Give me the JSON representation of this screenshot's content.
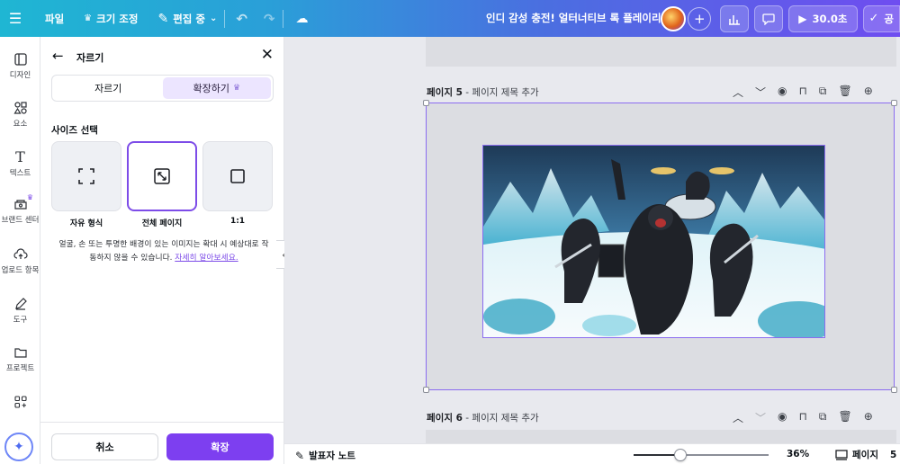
{
  "topbar": {
    "file_label": "파일",
    "resize_label": "크기 조정",
    "edit_label": "편집 중",
    "doc_title": "인디 감성 충전! 얼터너티브 록 플레이리스트",
    "present_label": "30.0초",
    "share_label": "공"
  },
  "rail": {
    "items": [
      {
        "label": "디자인",
        "icon": "layout-icon"
      },
      {
        "label": "요소",
        "icon": "elements-icon"
      },
      {
        "label": "텍스트",
        "icon": "text-icon"
      },
      {
        "label": "브랜드 센터",
        "icon": "brand-icon"
      },
      {
        "label": "업로드 항목",
        "icon": "upload-icon"
      },
      {
        "label": "도구",
        "icon": "draw-icon"
      },
      {
        "label": "프로젝트",
        "icon": "folder-icon"
      },
      {
        "label": "",
        "icon": "apps-icon"
      }
    ]
  },
  "panel": {
    "title": "자르기",
    "tab_crop": "자르기",
    "tab_expand": "확장하기",
    "section_title": "사이즈 선택",
    "options": [
      {
        "label": "자유 형식",
        "glyph": "⛶"
      },
      {
        "label": "전체 페이지",
        "glyph": "⤡"
      },
      {
        "label": "1:1",
        "glyph": "▢"
      }
    ],
    "note_text": "얼굴, 손 또는 투명한 배경이 있는 이미지는 확대 시 예상대로 작동하지 않을 수 있습니다.",
    "note_link": "자세히 알아보세요.",
    "cancel_label": "취소",
    "expand_label": "확장"
  },
  "canvas": {
    "page5_label": "페이지 5",
    "page5_title": "페이지 제목 추가",
    "page6_label": "페이지 6",
    "page6_title": "페이지 제목 추가",
    "separator": " - "
  },
  "bottombar": {
    "notes_label": "발표자 노트",
    "zoom": "36%",
    "zoom_level": 0.36,
    "pages_label": "페이지",
    "page_count": "5"
  }
}
